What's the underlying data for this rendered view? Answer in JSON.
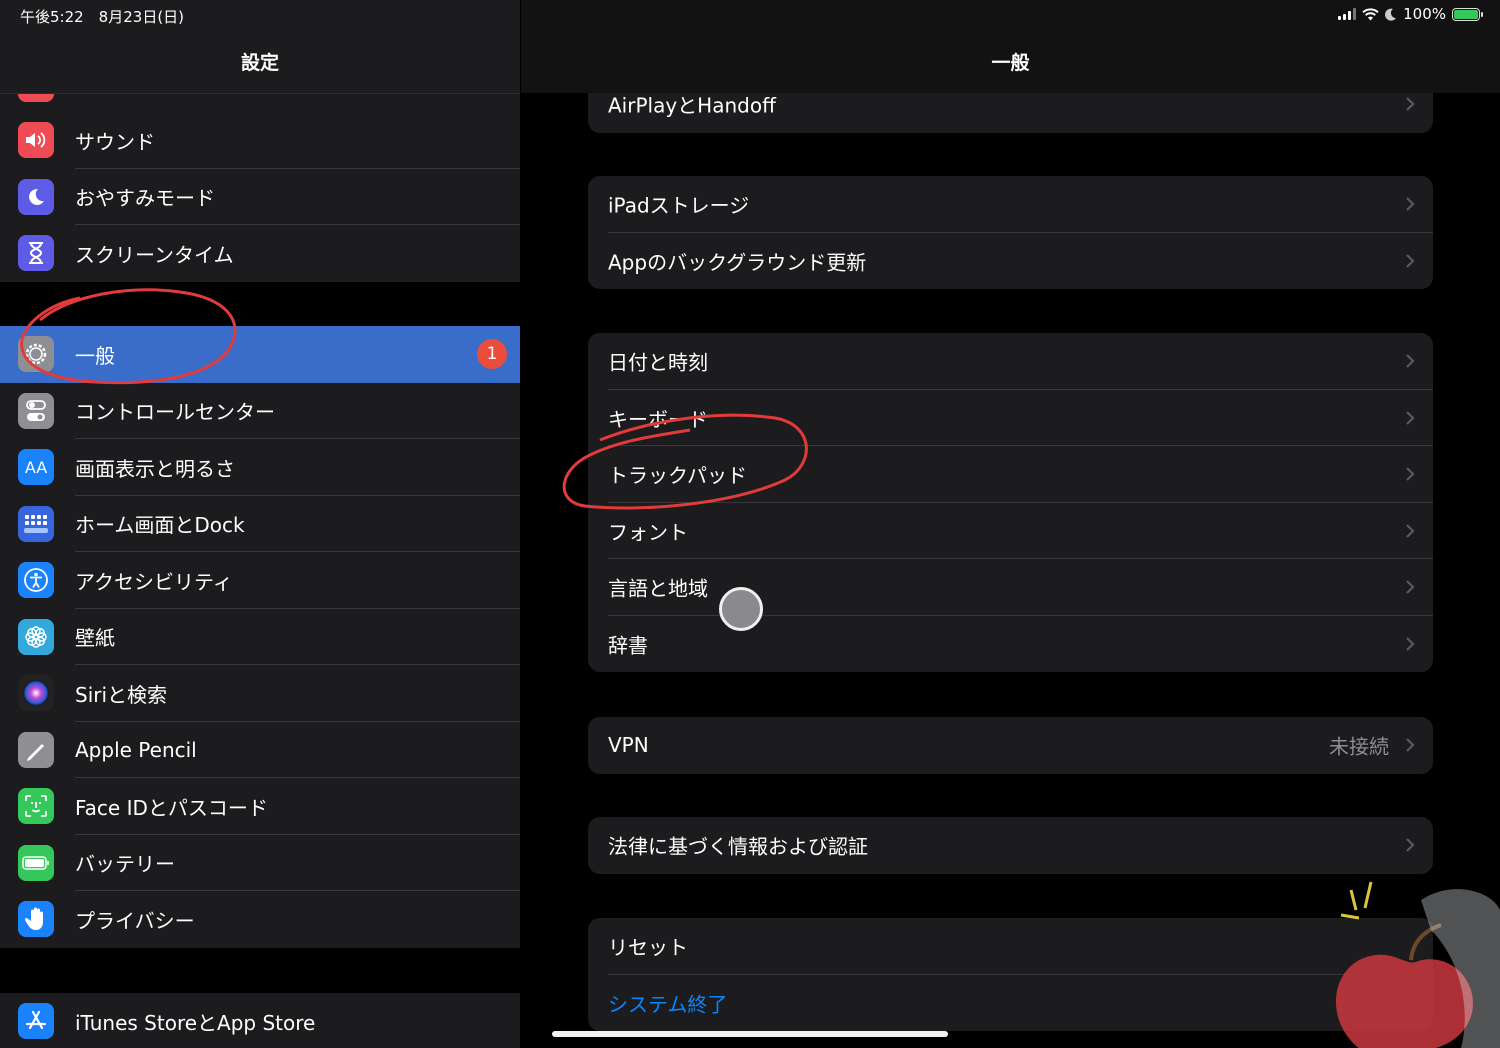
{
  "status_bar": {
    "time": "午後5:22　8月23日(日)",
    "battery_text": "100%",
    "battery_level": 1.0
  },
  "sidebar": {
    "title": "設定",
    "groups": [
      {
        "items": [
          {
            "label": "サウンド",
            "icon": "speaker-icon",
            "color": "#ef4b55"
          },
          {
            "label": "おやすみモード",
            "icon": "moon-icon",
            "color": "#5e5ce6"
          },
          {
            "label": "スクリーンタイム",
            "icon": "hourglass-icon",
            "color": "#5e5ce6"
          }
        ]
      },
      {
        "items": [
          {
            "label": "一般",
            "icon": "gear-icon",
            "color": "#8e8e93",
            "selected": true,
            "badge": "1"
          },
          {
            "label": "コントロールセンター",
            "icon": "toggles-icon",
            "color": "#8e8e93"
          },
          {
            "label": "画面表示と明るさ",
            "icon": "text-size-icon",
            "icon_text": "AA",
            "color": "#1a82fb"
          },
          {
            "label": "ホーム画面とDock",
            "icon": "home-grid-icon",
            "color": "#3867dd"
          },
          {
            "label": "アクセシビリティ",
            "icon": "accessibility-icon",
            "color": "#1a82fb"
          },
          {
            "label": "壁紙",
            "icon": "flower-icon",
            "color": "#32a8dd"
          },
          {
            "label": "Siriと検索",
            "icon": "siri-icon",
            "color": "#222"
          },
          {
            "label": "Apple Pencil",
            "icon": "pencil-icon",
            "color": "#8e8e93"
          },
          {
            "label": "Face IDとパスコード",
            "icon": "face-id-icon",
            "color": "#34c759"
          },
          {
            "label": "バッテリー",
            "icon": "battery-icon",
            "color": "#34c759"
          },
          {
            "label": "プライバシー",
            "icon": "hand-icon",
            "color": "#1a82fb"
          }
        ]
      },
      {
        "items": [
          {
            "label": "iTunes StoreとApp Store",
            "icon": "app-store-icon",
            "color": "#1a82fb"
          }
        ]
      }
    ]
  },
  "main": {
    "title": "一般",
    "groups": [
      {
        "rows": [
          {
            "label": "AirPlayとHandoff"
          }
        ]
      },
      {
        "rows": [
          {
            "label": "iPadストレージ"
          },
          {
            "label": "Appのバックグラウンド更新"
          }
        ]
      },
      {
        "rows": [
          {
            "label": "日付と時刻"
          },
          {
            "label": "キーボード"
          },
          {
            "label": "トラックパッド"
          },
          {
            "label": "フォント"
          },
          {
            "label": "言語と地域"
          },
          {
            "label": "辞書"
          }
        ]
      },
      {
        "rows": [
          {
            "label": "VPN",
            "value": "未接続"
          }
        ]
      },
      {
        "rows": [
          {
            "label": "法律に基づく情報および認証"
          }
        ]
      },
      {
        "rows": [
          {
            "label": "リセット"
          },
          {
            "label": "システム終了",
            "accent": "#0a84ff"
          }
        ]
      }
    ]
  }
}
